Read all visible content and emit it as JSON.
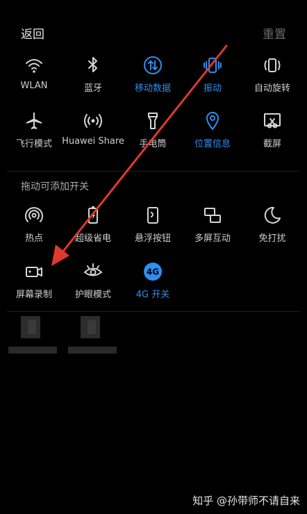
{
  "header": {
    "back_label": "返回",
    "reset_label": "重置"
  },
  "active_tiles": {
    "row1": [
      {
        "label": "WLAN",
        "icon": "wifi-icon",
        "active": false
      },
      {
        "label": "蓝牙",
        "icon": "bluetooth-icon",
        "active": false
      },
      {
        "label": "移动数据",
        "icon": "mobile-data-icon",
        "active": true
      },
      {
        "label": "振动",
        "icon": "vibrate-icon",
        "active": true
      },
      {
        "label": "自动旋转",
        "icon": "auto-rotate-icon",
        "active": false
      }
    ],
    "row2": [
      {
        "label": "飞行模式",
        "icon": "airplane-icon",
        "active": false
      },
      {
        "label": "Huawei Share",
        "icon": "huawei-share-icon",
        "active": false
      },
      {
        "label": "手电筒",
        "icon": "flashlight-icon",
        "active": false
      },
      {
        "label": "位置信息",
        "icon": "location-icon",
        "active": true
      },
      {
        "label": "截屏",
        "icon": "screenshot-icon",
        "active": false
      }
    ]
  },
  "section_title": "拖动可添加开关",
  "available_tiles": {
    "row1": [
      {
        "label": "热点",
        "icon": "hotspot-icon"
      },
      {
        "label": "超级省电",
        "icon": "battery-saver-icon"
      },
      {
        "label": "悬浮按钮",
        "icon": "floating-button-icon"
      },
      {
        "label": "多屏互动",
        "icon": "multi-screen-icon"
      },
      {
        "label": "免打扰",
        "icon": "do-not-disturb-icon"
      }
    ],
    "row2": [
      {
        "label": "屏幕录制",
        "icon": "screen-record-icon"
      },
      {
        "label": "护眼模式",
        "icon": "eye-comfort-icon"
      },
      {
        "label": "4G 开关",
        "icon": "4g-icon",
        "icon_text": "4G",
        "active": true
      }
    ]
  },
  "watermark": "知乎 @孙带师不请自来",
  "colors": {
    "active_blue": "#2f8ef0",
    "arrow_red": "#e0392f"
  }
}
